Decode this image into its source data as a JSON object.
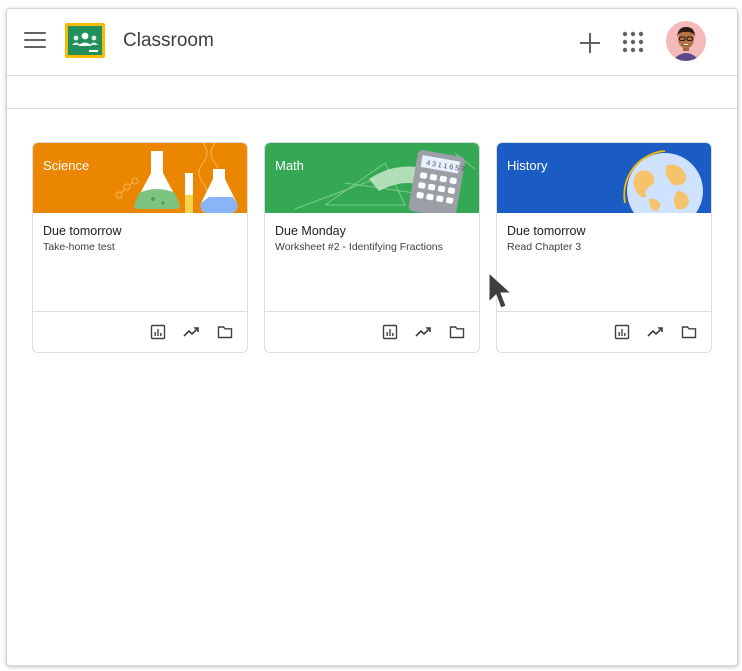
{
  "app": {
    "title": "Classroom"
  },
  "colors": {
    "science": "#ea8600",
    "math": "#34a853",
    "history": "#1a5bc4"
  },
  "courses": [
    {
      "name": "Science",
      "due_label": "Due tomorrow",
      "due_item": "Take-home test"
    },
    {
      "name": "Math",
      "due_label": "Due Monday",
      "due_item": "Worksheet #2 - Identifying Fractions"
    },
    {
      "name": "History",
      "due_label": "Due tomorrow",
      "due_item": "Read Chapter 3"
    }
  ],
  "icons": {
    "menu": "hamburger-menu-icon",
    "create": "plus-icon",
    "apps": "apps-grid-icon",
    "gradebook": "gradebook-icon",
    "trending": "trending-up-icon",
    "folder": "folder-icon"
  }
}
